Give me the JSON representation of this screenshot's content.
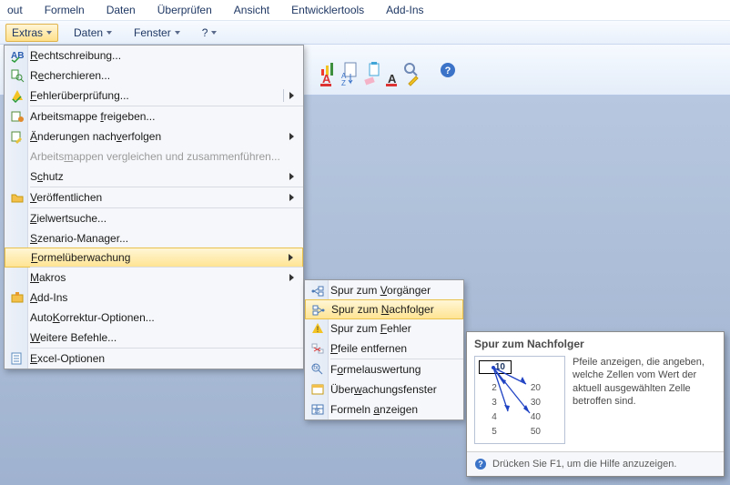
{
  "ribbon_tabs": [
    "out",
    "Formeln",
    "Daten",
    "Überprüfen",
    "Ansicht",
    "Entwicklertools",
    "Add-Ins"
  ],
  "sec_toolbar": {
    "extras": "Extras",
    "daten": "Daten",
    "fenster": "Fenster",
    "help": "?"
  },
  "extras_menu": {
    "items": [
      {
        "label": "Rechtschreibung...",
        "u": "R",
        "icon": "spell"
      },
      {
        "label": "Recherchieren...",
        "u": "R",
        "icon": "research"
      },
      {
        "label": "Fehlerüberprüfung...",
        "u": "F",
        "icon": "errcheck",
        "sub": true
      },
      {
        "label": "Arbeitsmappe freigeben...",
        "u": "f",
        "icon": "share"
      },
      {
        "label": "Änderungen nachverfolgen",
        "u": "Ä",
        "icon": "track",
        "sub": true
      },
      {
        "label": "Arbeitsmappen vergleichen und zusammenführen...",
        "u": "m",
        "disabled": true
      },
      {
        "label": "Schutz",
        "u": "c",
        "sub": true
      },
      {
        "label": "Veröffentlichen",
        "u": "V",
        "icon": "folder",
        "sub": true
      },
      {
        "label": "Zielwertsuche...",
        "u": "Z"
      },
      {
        "label": "Szenario-Manager...",
        "u": "S"
      },
      {
        "label": "Formelüberwachung",
        "u": "F",
        "hl": true,
        "sub": true
      },
      {
        "label": "Makros",
        "u": "M",
        "sub": true
      },
      {
        "label": "Add-Ins",
        "u": "A",
        "icon": "addin"
      },
      {
        "label": "AutoKorrektur-Optionen...",
        "u": "K"
      },
      {
        "label": "Weitere Befehle...",
        "u": "W"
      },
      {
        "label": "Excel-Optionen",
        "u": "E",
        "icon": "opts"
      }
    ]
  },
  "submenu": {
    "items": [
      {
        "label": "Spur zum Vorgänger",
        "u": "V",
        "icon": "trace-prec"
      },
      {
        "label": "Spur zum Nachfolger",
        "u": "N",
        "icon": "trace-dep",
        "hl": true
      },
      {
        "label": "Spur zum Fehler",
        "u": "F",
        "icon": "trace-err"
      },
      {
        "label": "Pfeile entfernen",
        "u": "P",
        "icon": "remove"
      },
      {
        "label": "Formelauswertung",
        "u": "o",
        "icon": "eval"
      },
      {
        "label": "Überwachungsfenster",
        "u": "w",
        "icon": "watch"
      },
      {
        "label": "Formeln anzeigen",
        "u": "a",
        "icon": "show"
      }
    ]
  },
  "tooltip": {
    "title": "Spur zum Nachfolger",
    "text": "Pfeile anzeigen, die angeben, welche Zellen vom Wert der aktuell ausgewählten Zelle betroffen sind.",
    "footer": "Drücken Sie F1, um die Hilfe anzuzeigen.",
    "cell_value": "10",
    "rows": [
      {
        "a": "2",
        "b": "20"
      },
      {
        "a": "3",
        "b": "30"
      },
      {
        "a": "4",
        "b": "40"
      },
      {
        "a": "5",
        "b": "50"
      }
    ]
  }
}
